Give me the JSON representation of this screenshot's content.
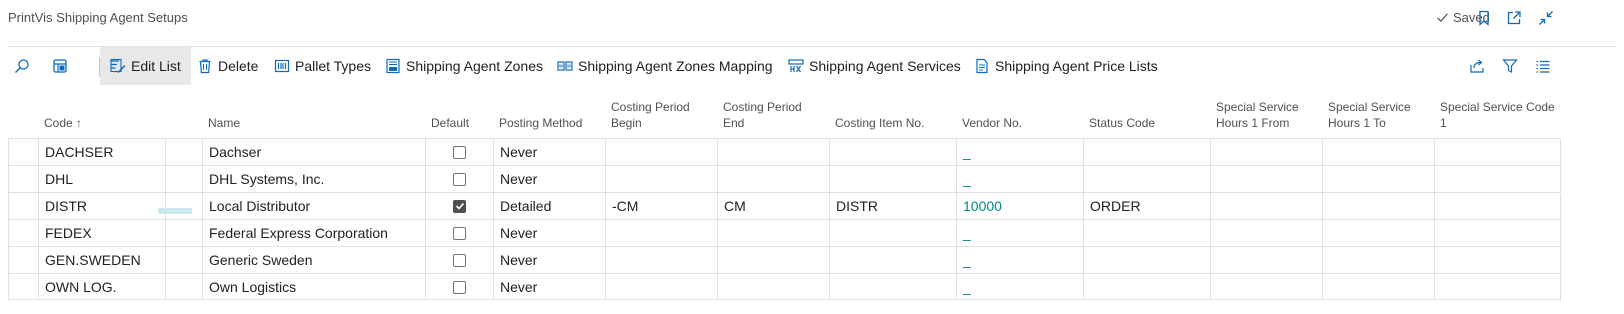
{
  "window": {
    "title": "PrintVis Shipping Agent Setups",
    "saved_label": "Saved"
  },
  "title_icons": [
    "bookmark-icon",
    "open-new-window-icon",
    "collapse-icon"
  ],
  "actions": {
    "edit_list": "Edit List",
    "delete": "Delete",
    "pallet_types": "Pallet Types",
    "shipping_agent_zones": "Shipping Agent Zones",
    "shipping_agent_zones_mapping": "Shipping Agent Zones Mapping",
    "shipping_agent_services": "Shipping Agent Services",
    "shipping_agent_price_lists": "Shipping Agent Price Lists"
  },
  "right_icons": [
    "share-icon",
    "filter-icon",
    "list-view-icon"
  ],
  "columns": {
    "code": "Code",
    "code_sort": "↑",
    "name": "Name",
    "default": "Default",
    "posting_method": "Posting Method",
    "costing_period_begin": "Costing Period Begin",
    "costing_period_end": "Costing Period End",
    "costing_item_no": "Costing Item No.",
    "vendor_no": "Vendor No.",
    "status_code": "Status Code",
    "special_hours_from": "Special Service Hours 1 From",
    "special_hours_to": "Special Service Hours 1 To",
    "special_code": "Special Service Code 1"
  },
  "rows": [
    {
      "code": "DACHSER",
      "name": "Dachser",
      "default": false,
      "posting_method": "Never",
      "cp_begin": "",
      "cp_end": "",
      "costing_item": "",
      "vendor_no": "_",
      "status_code": ""
    },
    {
      "code": "DHL",
      "name": "DHL Systems, Inc.",
      "default": false,
      "posting_method": "Never",
      "cp_begin": "",
      "cp_end": "",
      "costing_item": "",
      "vendor_no": "_",
      "status_code": ""
    },
    {
      "code": "DISTR",
      "name": "Local Distributor",
      "default": true,
      "posting_method": "Detailed",
      "cp_begin": "-CM",
      "cp_end": "CM",
      "costing_item": "DISTR",
      "vendor_no": "10000",
      "status_code": "ORDER"
    },
    {
      "code": "FEDEX",
      "name": "Federal Express Corporation",
      "default": false,
      "posting_method": "Never",
      "cp_begin": "",
      "cp_end": "",
      "costing_item": "",
      "vendor_no": "_",
      "status_code": ""
    },
    {
      "code": "GEN.SWEDEN",
      "name": "Generic Sweden",
      "default": false,
      "posting_method": "Never",
      "cp_begin": "",
      "cp_end": "",
      "costing_item": "",
      "vendor_no": "_",
      "status_code": ""
    },
    {
      "code": "OWN LOG.",
      "name": "Own Logistics",
      "default": false,
      "posting_method": "Never",
      "cp_begin": "",
      "cp_end": "",
      "costing_item": "",
      "vendor_no": "_",
      "status_code": ""
    }
  ],
  "colors": {
    "link": "#008489",
    "selected_action_bg": "#e8e8e8",
    "grid_line": "#e0e0e0",
    "accent_icon": "#0f6cbd"
  }
}
